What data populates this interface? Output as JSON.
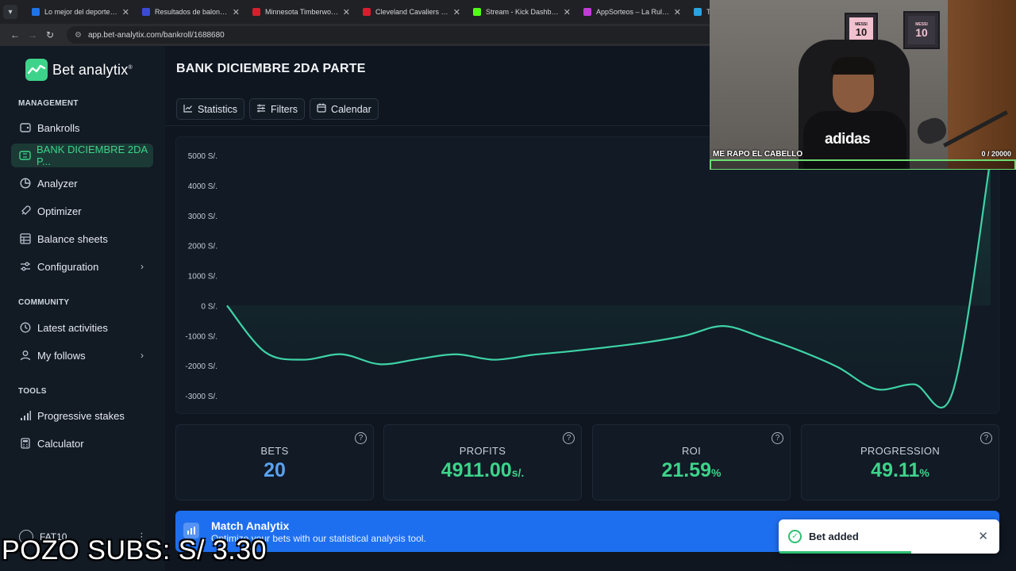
{
  "browser": {
    "tabs": [
      {
        "label": "Lo mejor del deporte y el",
        "color": "#1e73e8"
      },
      {
        "label": "Resultados de baloncesto",
        "color": "#3b4bd8"
      },
      {
        "label": "Minnesota Timberwolves",
        "color": "#d81e2c"
      },
      {
        "label": "Cleveland Cavaliers - Chic",
        "color": "#d81e2c"
      },
      {
        "label": "Stream - Kick Dashboard",
        "color": "#53fc18"
      },
      {
        "label": "AppSorteos – La Ruleta d",
        "color": "#c23bd8"
      },
      {
        "label": "Teleg",
        "color": "#2aa3e0"
      }
    ],
    "url": "app.bet-analytix.com/bankroll/1688680"
  },
  "sidebar": {
    "brand": "Bet analytix",
    "brand_mark": "®",
    "sections": {
      "management": "MANAGEMENT",
      "community": "COMMUNITY",
      "tools": "TOOLS"
    },
    "management_items": [
      {
        "label": "Bankrolls",
        "icon": "wallet-icon"
      },
      {
        "label": "BANK DICIEMBRE 2DA P...",
        "icon": "ticket-icon"
      },
      {
        "label": "Analyzer",
        "icon": "pie-chart-icon"
      },
      {
        "label": "Optimizer",
        "icon": "rocket-icon"
      },
      {
        "label": "Balance sheets",
        "icon": "table-icon"
      },
      {
        "label": "Configuration",
        "icon": "gear-icon"
      }
    ],
    "community_items": [
      {
        "label": "Latest activities",
        "icon": "clock-icon"
      },
      {
        "label": "My follows",
        "icon": "user-icon"
      }
    ],
    "tools_items": [
      {
        "label": "Progressive stakes",
        "icon": "bars-icon"
      },
      {
        "label": "Calculator",
        "icon": "calculator-icon"
      }
    ],
    "user": {
      "name": "FAT10"
    }
  },
  "main": {
    "title": "BANK DICIEMBRE 2DA PARTE",
    "tabs": [
      {
        "label": "Statistics",
        "icon": "line-chart-icon"
      },
      {
        "label": "Filters",
        "icon": "filters-icon"
      },
      {
        "label": "Calendar",
        "icon": "calendar-icon"
      }
    ]
  },
  "chart_data": {
    "type": "area",
    "title": "",
    "xlabel": "",
    "ylabel": "",
    "y_ticks": [
      "5000 S/.",
      "4000 S/.",
      "3000 S/.",
      "2000 S/.",
      "1000 S/.",
      "0 S/.",
      "-1000 S/.",
      "-2000 S/.",
      "-3000 S/."
    ],
    "ylim": [
      -3000,
      5000
    ],
    "x": [
      0,
      1,
      2,
      3,
      4,
      5,
      6,
      7,
      8,
      9,
      10,
      11,
      12,
      13,
      14,
      15,
      16,
      17,
      18,
      19,
      20
    ],
    "values": [
      0,
      -1550,
      -1800,
      -1620,
      -1950,
      -1780,
      -1620,
      -1800,
      -1640,
      -1520,
      -1380,
      -1220,
      -1000,
      -680,
      -1050,
      -1500,
      -2050,
      -2780,
      -2620,
      -2900,
      4911
    ],
    "line_color": "#3ed3a6",
    "grid": false
  },
  "stats": [
    {
      "label": "BETS",
      "value": "20",
      "unit": "",
      "color": "#5aa2f0"
    },
    {
      "label": "PROFITS",
      "value": "4911.00",
      "unit": "s/.",
      "color": "#3ed38a"
    },
    {
      "label": "ROI",
      "value": "21.59",
      "unit": "%",
      "color": "#3ed38a"
    },
    {
      "label": "PROGRESSION",
      "value": "49.11",
      "unit": "%",
      "color": "#3ed38a"
    }
  ],
  "banner": {
    "title": "Match Analytix",
    "subtitle": "Optimize your bets with our statistical analysis tool."
  },
  "toast": {
    "message": "Bet added",
    "progress": 0.6
  },
  "webcam": {
    "caption": "ME RAPO EL CABELLO",
    "goal": "0 / 20000",
    "shirt": "adidas",
    "jersey_name": "MESSI",
    "jersey_number": "10"
  },
  "overlay_text": "POZO SUBS: S/ 3.30"
}
